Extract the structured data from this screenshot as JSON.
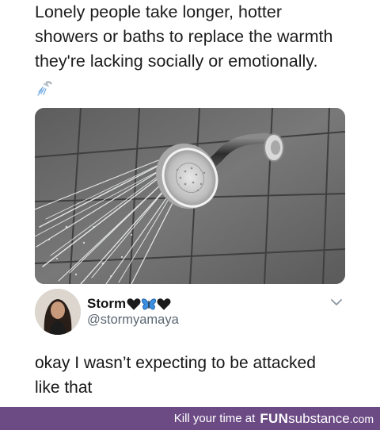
{
  "post": {
    "quote_lines": [
      "Lonely people take longer, hotter",
      "showers or baths to replace the warmth",
      "they're lacking socially or emotionally."
    ],
    "emoji": "shower-emoji",
    "image": "shower-head-photo"
  },
  "tweet": {
    "display_name": "Storm",
    "name_emojis": [
      "black-heart-emoji",
      "blue-butterfly-emoji",
      "black-heart-emoji"
    ],
    "handle": "@stormyamaya",
    "body_lines": [
      "okay I wasn’t expecting to be attacked",
      "like that"
    ]
  },
  "footer": {
    "tagline": "Kill your time at",
    "brand_fun": "FUN",
    "brand_substance": "substance",
    "brand_tld": ".com",
    "color": "#6c4b85"
  }
}
